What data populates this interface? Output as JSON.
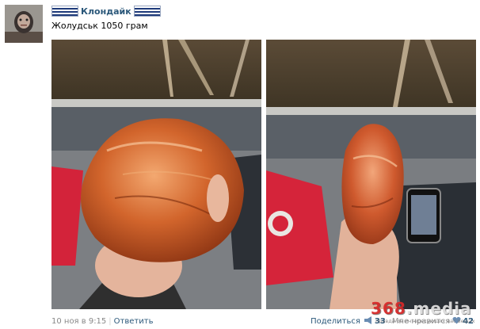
{
  "post": {
    "author": "Клондайк",
    "text": "Жолудськ 1050 грам",
    "timestamp": "10 ноя в 9:15",
    "reply_label": "Ответить",
    "share_label": "Поделиться",
    "share_count": "33",
    "like_label": "Мне нравится",
    "like_count": "42"
  },
  "icons": {
    "avatar": "avatar-image",
    "flag": "flag-icon",
    "share": "megaphone-icon",
    "like": "heart-icon"
  },
  "photos": [
    {
      "name": "photo-amber-front"
    },
    {
      "name": "photo-amber-side"
    }
  ],
  "watermark": {
    "logo_digits": "368",
    "logo_sep": ".",
    "logo_word": "media",
    "tagline": "правда об интересующих вас вещах"
  },
  "colors": {
    "link": "#2b587a",
    "meta": "#888888",
    "amber": "#c8602a"
  }
}
